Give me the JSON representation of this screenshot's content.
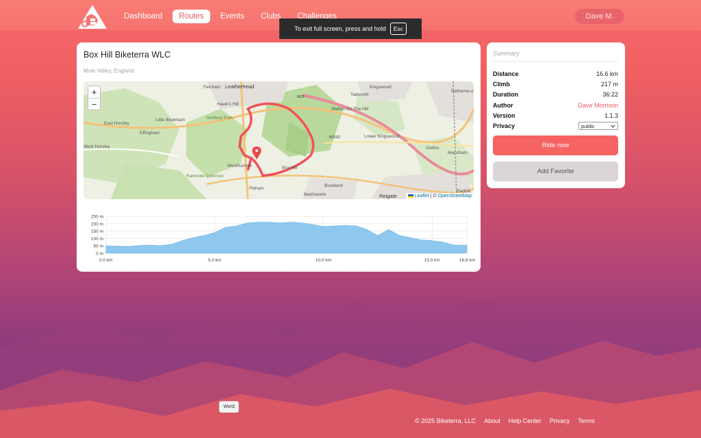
{
  "nav": {
    "items": [
      "Dashboard",
      "Routes",
      "Events",
      "Clubs",
      "Challenges"
    ],
    "active": "Routes",
    "user": "Dave M."
  },
  "fullscreen_toast": {
    "text": "To exit full screen, press and hold",
    "key": "Esc"
  },
  "route": {
    "title": "Box Hill Biketerra WLC",
    "location": "Mole Valley, England"
  },
  "map": {
    "zoom_in": "+",
    "zoom_out": "−",
    "attribution_leaflet": "Leaflet",
    "attribution_sep": " | © ",
    "attribution_osm": "OpenStreetMap",
    "labels": [
      "Fetcham",
      "Leatherhead",
      "M25",
      "Tadworth",
      "Kingswood",
      "Netherne-on-the-Hill",
      "Hawk's Hill",
      "Little Bookham",
      "East Horsley",
      "Effingham",
      "Norbury Park",
      "Walton On The Hill",
      "B2032",
      "Lower Kingswood",
      "Gatton",
      "Merstham",
      "West Horsley",
      "Westhumble",
      "Box Hill",
      "Ranmore Common",
      "Pixham",
      "Buckland",
      "Betchworth",
      "Reigate",
      "Redhill"
    ]
  },
  "elevation": {
    "y_ticks": [
      "250 m",
      "200 m",
      "150 m",
      "100 m",
      "50 m",
      "0 m"
    ],
    "x_ticks": [
      "0.0 km",
      "5.0 km",
      "10.0 km",
      "15.0 km",
      "16.6 km"
    ],
    "fill_color": "#8ec8ef",
    "profile_km": [
      0,
      0.5,
      1.0,
      1.5,
      2.0,
      2.5,
      3.0,
      3.5,
      4.0,
      4.5,
      5.0,
      5.5,
      6.0,
      6.5,
      7.0,
      7.5,
      8.0,
      8.5,
      9.0,
      9.5,
      10.0,
      10.5,
      11.0,
      11.5,
      12.0,
      12.5,
      13.0,
      13.5,
      14.0,
      14.5,
      15.0,
      15.5,
      16.0,
      16.6
    ],
    "profile_m": [
      50,
      47,
      45,
      52,
      55,
      52,
      60,
      85,
      105,
      120,
      140,
      175,
      185,
      205,
      210,
      210,
      205,
      210,
      205,
      195,
      180,
      185,
      188,
      185,
      160,
      120,
      160,
      120,
      105,
      90,
      85,
      75,
      55,
      55
    ]
  },
  "summary": {
    "title": "Summary",
    "rows": [
      {
        "k": "Distance",
        "v": "16.6 km"
      },
      {
        "k": "Climb",
        "v": "217 m"
      },
      {
        "k": "Duration",
        "v": "36:22"
      },
      {
        "k": "Author",
        "v": "Dave Morrison"
      },
      {
        "k": "Version",
        "v": "1.1.3"
      },
      {
        "k": "Privacy",
        "v": "public"
      }
    ],
    "ride_now": "Ride now",
    "add_favorite": "Add Favorite"
  },
  "tooltip": "Word",
  "footer": {
    "copyright": "© 2025 Biketerra, LLC",
    "links": [
      "About",
      "Help Center",
      "Privacy",
      "Terms"
    ]
  },
  "colors": {
    "accent": "#f66363",
    "nav_bg": "#f77371",
    "link": "#ea5b5f",
    "route_line": "#f0525a"
  }
}
